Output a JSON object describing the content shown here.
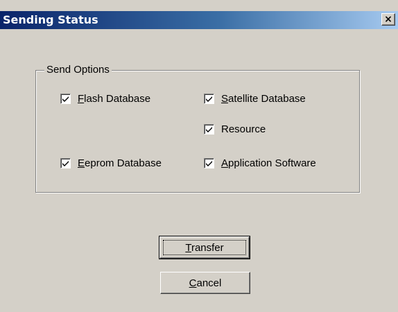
{
  "window": {
    "title": "Sending Status",
    "close_symbol": "×"
  },
  "send_options": {
    "group_label": "Send Options",
    "items": [
      {
        "label": "Flash Database",
        "accel": "F",
        "rest": "lash Database",
        "checked": true
      },
      {
        "label": "Satellite Database",
        "accel": "S",
        "rest": "atellite Database",
        "checked": true
      },
      {
        "label": "Resource",
        "accel": "",
        "rest": "Resource",
        "checked": true
      },
      {
        "label": "Eeprom Database",
        "accel": "E",
        "rest": "eprom Database",
        "checked": true
      },
      {
        "label": "Application Software",
        "accel": "A",
        "rest": "pplication Software",
        "checked": true
      }
    ]
  },
  "buttons": {
    "transfer": {
      "label": "Transfer",
      "accel": "T",
      "rest": "ransfer",
      "default": true
    },
    "cancel": {
      "label": "Cancel",
      "accel": "C",
      "rest": "ancel"
    }
  },
  "icons": {
    "checkmark": "checkmark-icon",
    "close": "close-icon"
  }
}
